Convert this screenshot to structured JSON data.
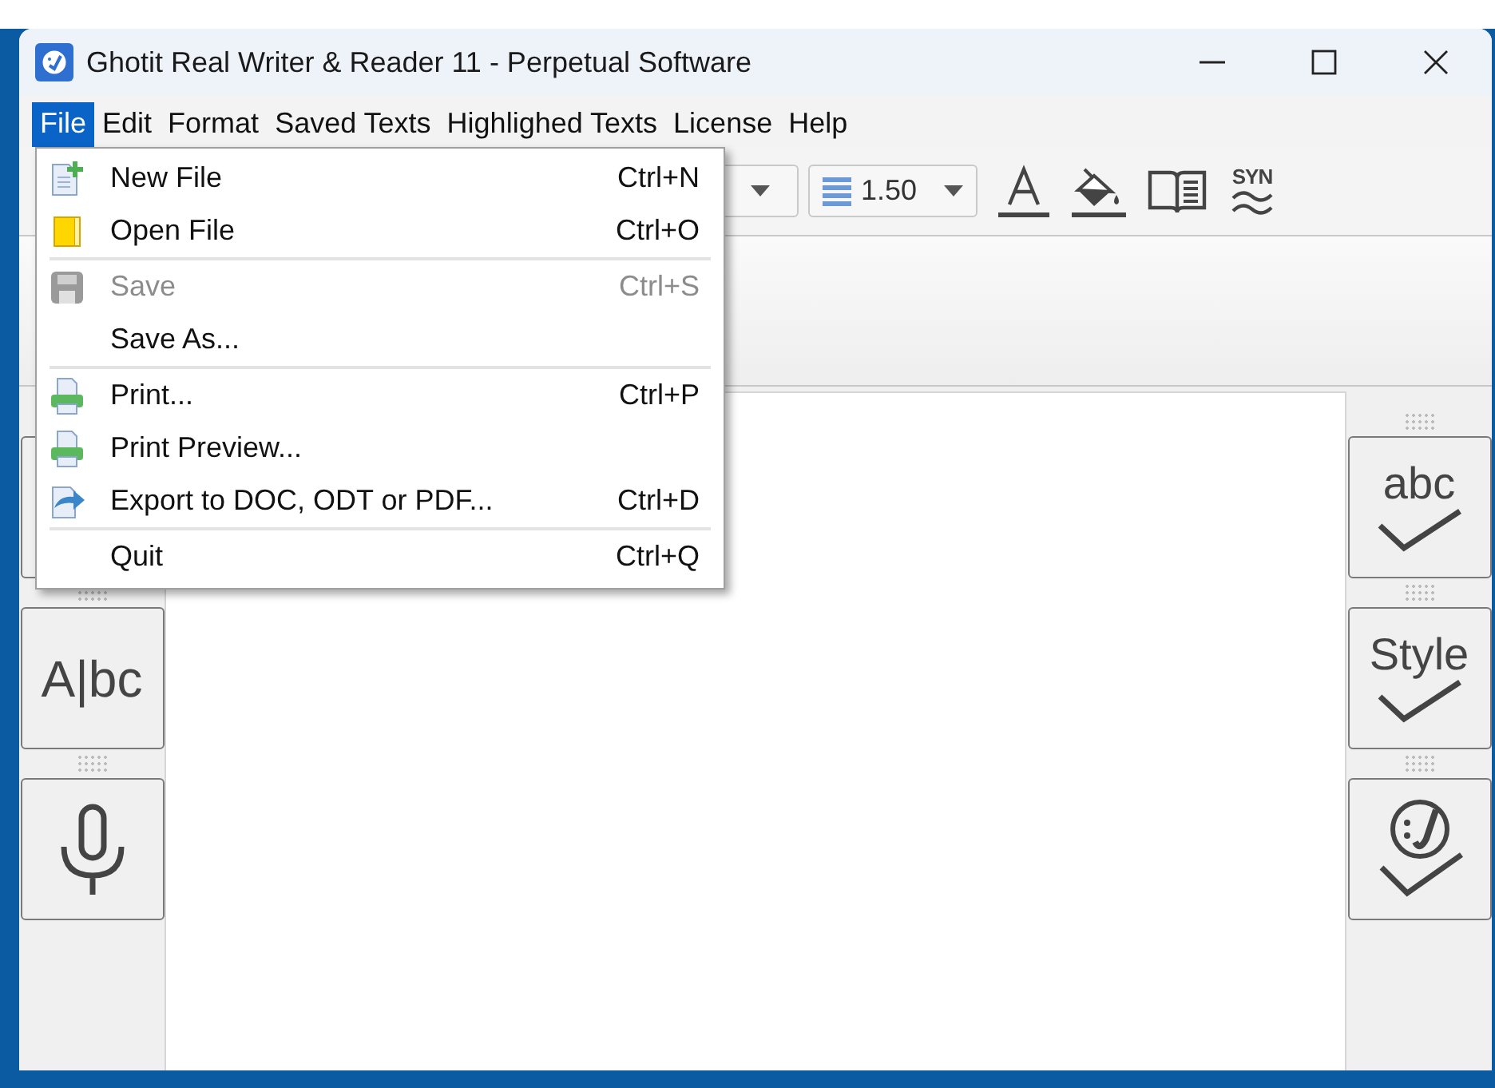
{
  "window": {
    "title": "Ghotit Real Writer & Reader 11 - Perpetual Software"
  },
  "menu_bar": [
    {
      "label": "File",
      "selected": true
    },
    {
      "label": "Edit",
      "selected": false
    },
    {
      "label": "Format",
      "selected": false
    },
    {
      "label": "Saved Texts",
      "selected": false
    },
    {
      "label": "Highlighed Texts",
      "selected": false
    },
    {
      "label": "License",
      "selected": false
    },
    {
      "label": "Help",
      "selected": false
    }
  ],
  "toolbar": {
    "line_spacing": "1.50",
    "synonyms": "SYN"
  },
  "file_menu": {
    "groups": [
      [
        {
          "kind": "new",
          "label": "New File",
          "shortcut": "Ctrl+N",
          "disabled": false
        },
        {
          "kind": "open",
          "label": "Open File",
          "shortcut": "Ctrl+O",
          "disabled": false
        }
      ],
      [
        {
          "kind": "save",
          "label": "Save",
          "shortcut": "Ctrl+S",
          "disabled": true
        },
        {
          "kind": "plain",
          "label": "Save As...",
          "disabled": false
        }
      ],
      [
        {
          "kind": "print",
          "label": "Print...",
          "shortcut": "Ctrl+P",
          "disabled": false
        },
        {
          "kind": "print",
          "label": "Print Preview...",
          "disabled": false
        },
        {
          "kind": "export",
          "label": "Export to DOC, ODT or PDF...",
          "shortcut": "Ctrl+D",
          "disabled": false
        }
      ],
      [
        {
          "kind": "plain",
          "label": "Quit",
          "shortcut": "Ctrl+Q",
          "disabled": false
        }
      ]
    ]
  },
  "left_panel": [
    {
      "kind": "blank"
    },
    {
      "kind": "text",
      "label": "A|bc"
    },
    {
      "kind": "mic"
    }
  ],
  "right_panel": [
    {
      "kind": "check",
      "label": "abc"
    },
    {
      "kind": "check",
      "label": "Style"
    },
    {
      "kind": "smiley"
    }
  ]
}
